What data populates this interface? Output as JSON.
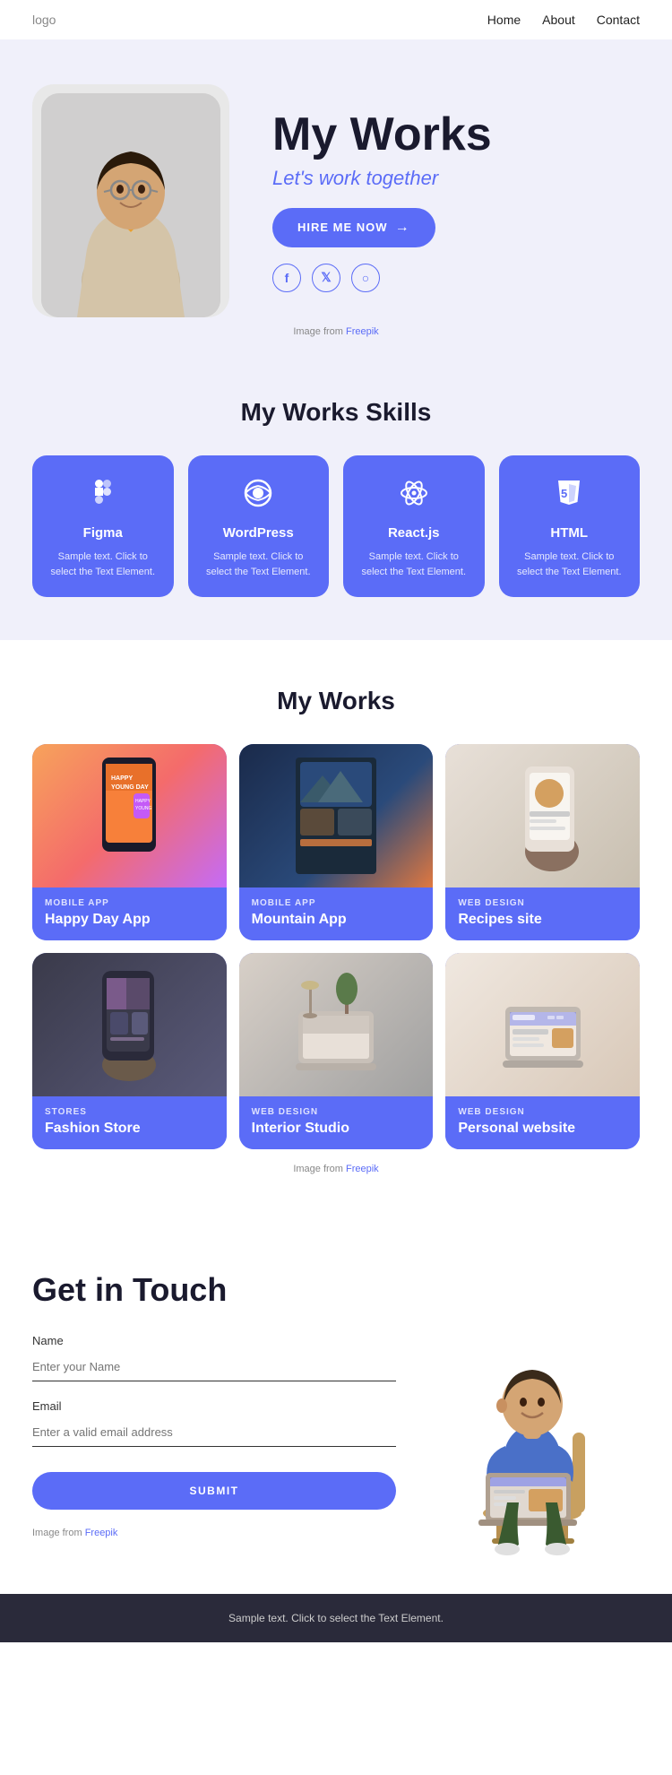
{
  "nav": {
    "logo": "logo",
    "links": [
      {
        "label": "Home",
        "id": "home"
      },
      {
        "label": "About",
        "id": "about"
      },
      {
        "label": "Contact",
        "id": "contact"
      }
    ]
  },
  "hero": {
    "title": "My Works",
    "subtitle": "Let's work together",
    "hire_btn": "HIRE ME NOW",
    "attribution_prefix": "Image from ",
    "attribution_link": "Freepik",
    "socials": [
      {
        "icon": "f",
        "name": "facebook"
      },
      {
        "icon": "𝕏",
        "name": "twitter"
      },
      {
        "icon": "◎",
        "name": "instagram"
      }
    ]
  },
  "skills": {
    "title": "My Works Skills",
    "items": [
      {
        "name": "Figma",
        "desc": "Sample text. Click to select the Text Element.",
        "icon": "✦"
      },
      {
        "name": "WordPress",
        "desc": "Sample text. Click to select the Text Element.",
        "icon": "⊕"
      },
      {
        "name": "React.js",
        "desc": "Sample text. Click to select the Text Element.",
        "icon": "⚛"
      },
      {
        "name": "HTML",
        "desc": "Sample text. Click to select the Text Element.",
        "icon": "⬡"
      }
    ]
  },
  "works": {
    "title": "My Works",
    "items": [
      {
        "category": "MOBILE APP",
        "name": "Happy Day App",
        "color_class": "w1",
        "emoji": "📱"
      },
      {
        "category": "MOBILE APP",
        "name": "Mountain App",
        "color_class": "w2",
        "emoji": "🏔"
      },
      {
        "category": "WEB DESIGN",
        "name": "Recipes site",
        "color_class": "w3",
        "emoji": "🍽"
      },
      {
        "category": "STORES",
        "name": "Fashion Store",
        "color_class": "w4",
        "emoji": "👗"
      },
      {
        "category": "WEB DESIGN",
        "name": "Interior Studio",
        "color_class": "w5",
        "emoji": "🛋"
      },
      {
        "category": "WEB DESIGN",
        "name": "Personal website",
        "color_class": "w6",
        "emoji": "💻"
      }
    ],
    "attribution_prefix": "Image from ",
    "attribution_link": "Freepik"
  },
  "contact": {
    "title": "Get in Touch",
    "fields": [
      {
        "label": "Name",
        "placeholder": "Enter your Name",
        "type": "text",
        "id": "name"
      },
      {
        "label": "Email",
        "placeholder": "Enter a valid email address",
        "type": "email",
        "id": "email"
      }
    ],
    "submit_btn": "SUBMIT",
    "attribution_prefix": "Image from ",
    "attribution_link": "Freepik"
  },
  "footer": {
    "text": "Sample text. Click to select the Text Element."
  }
}
